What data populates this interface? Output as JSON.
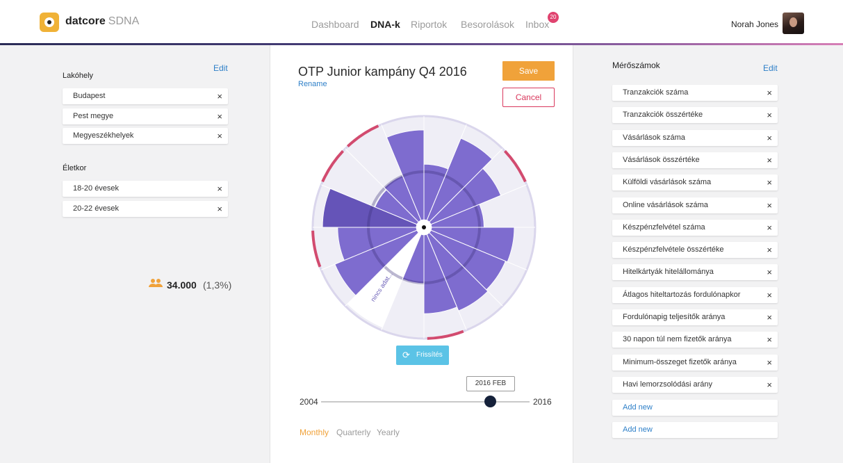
{
  "header": {
    "brand": "datcore",
    "brand_suffix": "SDNA",
    "nav": [
      "Dashboard",
      "DNA-k",
      "Riportok",
      "Besorolások",
      "Inbox"
    ],
    "inbox_badge": "20",
    "user_name": "Norah Jones"
  },
  "left": {
    "edit_label": "Edit",
    "residence_title": "Lakóhely",
    "residence": [
      "Budapest",
      "Pest megye",
      "Megyeszékhelyek"
    ],
    "age_title": "Életkor",
    "ages": [
      "18-20 évesek",
      "20-22 évesek"
    ],
    "count": "34.000",
    "percent": "(1,3%)"
  },
  "center": {
    "title": "OTP Junior kampány Q4 2016",
    "rename": "Rename",
    "save": "Save",
    "cancel": "Cancel",
    "no_data": "nincs adat...",
    "refresh": "Frissítés",
    "slider_tooltip": "2016 FEB",
    "slider_min": "2004",
    "slider_max": "2016",
    "slider_value_fraction": 0.81,
    "ranges": [
      "Monthly",
      "Quarterly",
      "Yearly"
    ]
  },
  "right": {
    "title": "Mérőszámok",
    "edit_label": "Edit",
    "metrics": [
      "Tranzakciók száma",
      "Tranzakciók összértéke",
      "Vásárlások száma",
      "Vásárlások összértéke",
      "Külföldi vásárlások száma",
      "Online vásárlások száma",
      "Készpénzfelvétel száma",
      "Készpénzfelvétele összértéke",
      "Hitelkártyák hitelállománya",
      "Átlagos hiteltartozás fordulónapkor",
      "Fordulónapig teljesítők aránya",
      "30 napon túl nem fizetők aránya",
      "Minimum-összeget fizetők aránya",
      "Havi lemorzsolódási arány"
    ],
    "add_new": [
      "Add new",
      "Add new"
    ]
  },
  "chart_data": {
    "type": "radial-bar",
    "segments": 16,
    "values": [
      0.55,
      0.88,
      0.75,
      0.52,
      0.82,
      0.8,
      0.82,
      0.78,
      0.48,
      0.55,
      0.88,
      0.78,
      0.93,
      0.45,
      0.48,
      0.89
    ],
    "highlight_rings": [
      2,
      7,
      11,
      13,
      14
    ],
    "empty_segment": 9,
    "colors": {
      "bar": "#7e6ccf",
      "bar_dark": "#6554b8",
      "bg": "#efeef6",
      "ring": "#dad6ec",
      "accent": "#d24b6f"
    }
  }
}
